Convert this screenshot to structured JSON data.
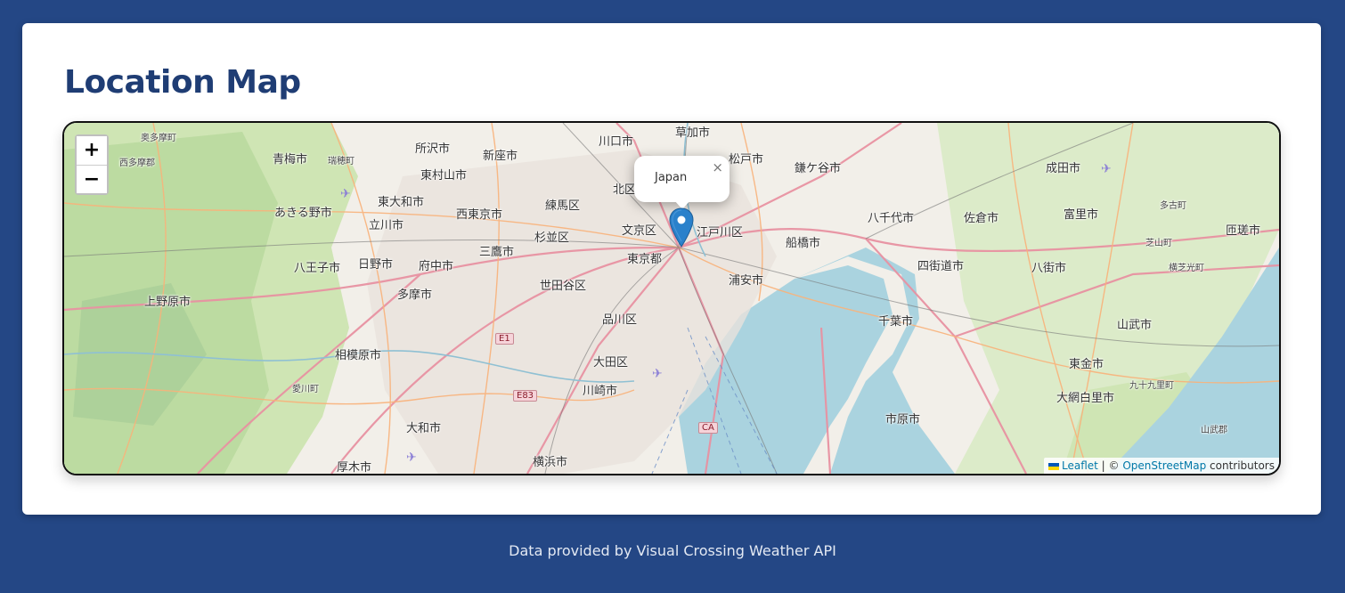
{
  "page": {
    "title": "Location Map",
    "footer": "Data provided by Visual Crossing Weather API"
  },
  "map": {
    "zoom_in_label": "+",
    "zoom_out_label": "−",
    "popup_text": "Japan",
    "popup_close": "×",
    "attribution": {
      "leaflet": "Leaflet",
      "separator": " | © ",
      "osm": "OpenStreetMap",
      "suffix": " contributors"
    },
    "place_labels": [
      "奥多摩町",
      "西多摩郡",
      "青梅市",
      "瑞穂町",
      "所沢市",
      "新座市",
      "川口市",
      "草加市",
      "松戸市",
      "鎌ケ谷市",
      "成田市",
      "東村山市",
      "東大和市",
      "練馬区",
      "北区",
      "西東京市",
      "あきる野市",
      "立川市",
      "八千代市",
      "佐倉市",
      "富里市",
      "多古町",
      "文京区",
      "江戸川区",
      "船橋市",
      "匝瑳市",
      "杉並区",
      "三鷹市",
      "東京都",
      "芝山町",
      "八王子市",
      "日野市",
      "府中市",
      "四街道市",
      "八街市",
      "横芝光町",
      "上野原市",
      "世田谷区",
      "浦安市",
      "多摩市",
      "品川区",
      "千葉市",
      "山武市",
      "相模原市",
      "大田区",
      "東金市",
      "愛川町",
      "川崎市",
      "九十九里町",
      "大網白里市",
      "市原市",
      "大和市",
      "山武郡",
      "厚木市",
      "横浜市",
      "E1",
      "E83",
      "CA"
    ],
    "accent_colors": {
      "water": "#aad3df",
      "land": "#f2efe9",
      "park": "#c8e3b0",
      "marker": "#2a81cb",
      "motorway": "#e892a2"
    }
  }
}
